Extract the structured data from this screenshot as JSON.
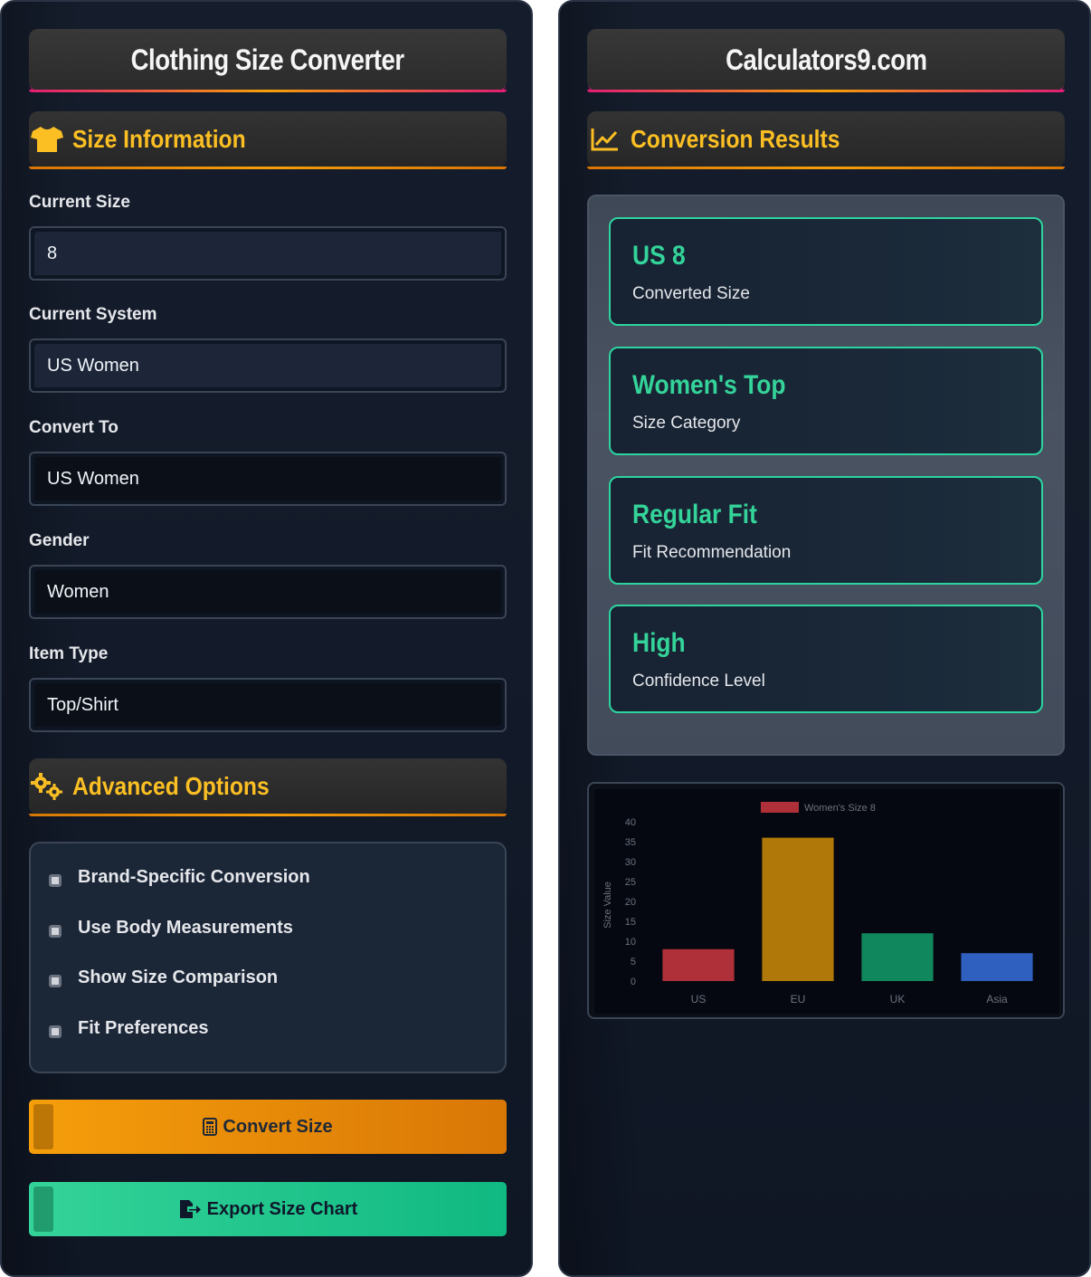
{
  "left_panel": {
    "title": "Clothing Size Converter",
    "size_info_heading": "Size Information",
    "fields": [
      {
        "label": "Current Size",
        "value": "8"
      },
      {
        "label": "Current System",
        "value": "US Women"
      },
      {
        "label": "Convert To",
        "value": "US Women"
      },
      {
        "label": "Gender",
        "value": "Women"
      },
      {
        "label": "Item Type",
        "value": "Top/Shirt"
      }
    ],
    "advanced_heading": "Advanced Options",
    "options": [
      "Brand-Specific Conversion",
      "Use Body Measurements",
      "Show Size Comparison",
      "Fit Preferences"
    ],
    "convert_button": "Convert Size",
    "export_button": "Export Size Chart"
  },
  "right_panel": {
    "title": "Calculators9.com",
    "results_heading": "Conversion Results",
    "results": [
      {
        "value": "US 8",
        "label": "Converted Size"
      },
      {
        "value": "Women's Top",
        "label": "Size Category"
      },
      {
        "value": "Regular Fit",
        "label": "Fit Recommendation"
      },
      {
        "value": "High",
        "label": "Confidence Level"
      }
    ]
  },
  "colors": {
    "accent_yellow": "#fbbf24",
    "accent_green": "#34d399",
    "accent_orange": "#f59e0b"
  },
  "chart_data": {
    "type": "bar",
    "categories": [
      "US",
      "EU",
      "UK",
      "Asia"
    ],
    "series": [
      {
        "name": "Women's Size 8",
        "values": [
          8,
          36,
          12,
          7
        ]
      }
    ],
    "bar_colors": [
      "#b0303a",
      "#b07808",
      "#11875e",
      "#2f5fbf"
    ],
    "legend_color": "#b0303a",
    "ylabel": "Size Value",
    "xlabel": "",
    "ylim": [
      0,
      40
    ],
    "yticks": [
      0,
      5,
      10,
      15,
      20,
      25,
      30,
      35,
      40
    ],
    "legend_position": "top",
    "grid": false
  }
}
